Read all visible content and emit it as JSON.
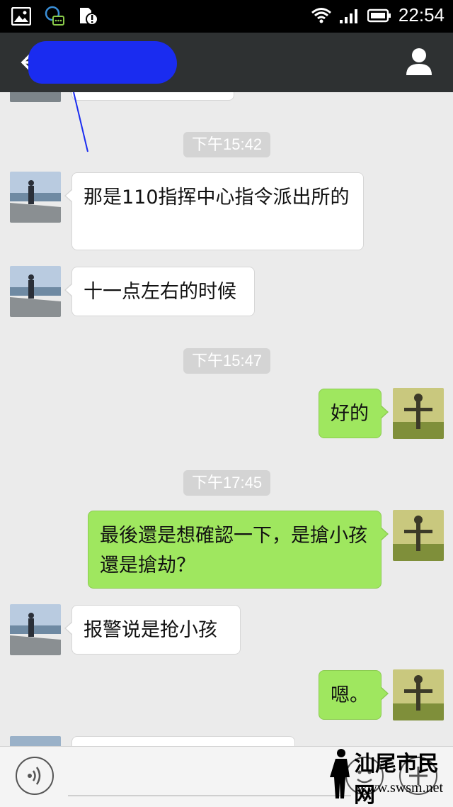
{
  "status_bar": {
    "time": "22:54",
    "icons": [
      "image-notification-icon",
      "chat-notification-icon",
      "sd-card-alert-icon",
      "wifi-icon",
      "signal-icon",
      "battery-icon"
    ]
  },
  "header": {
    "contact_name": "",
    "back_icon": "back-arrow-icon",
    "profile_icon": "person-icon"
  },
  "messages": [
    {
      "type": "time",
      "text": "下午15:42"
    },
    {
      "type": "in",
      "text": "那是110指挥中心指令派出所的"
    },
    {
      "type": "in",
      "text": "十一点左右的时候"
    },
    {
      "type": "time",
      "text": "下午15:47"
    },
    {
      "type": "out",
      "text": "好的"
    },
    {
      "type": "time",
      "text": "下午17:45"
    },
    {
      "type": "out",
      "text": "最後還是想確認一下，是搶小孩還是搶劫？"
    },
    {
      "type": "in",
      "text": "报警说是抢小孩"
    },
    {
      "type": "out",
      "text": "嗯。"
    }
  ],
  "input_bar": {
    "voice_icon": "voice-icon",
    "emoji_icon": "emoji-icon",
    "plus_icon": "plus-icon"
  },
  "watermark": {
    "text": "汕尾市民网",
    "url": "www.swsm.net"
  },
  "colors": {
    "header_bg": "#2e3132",
    "chat_bg": "#ebebeb",
    "outgoing_bubble": "#9fe75f",
    "incoming_bubble": "#ffffff"
  }
}
